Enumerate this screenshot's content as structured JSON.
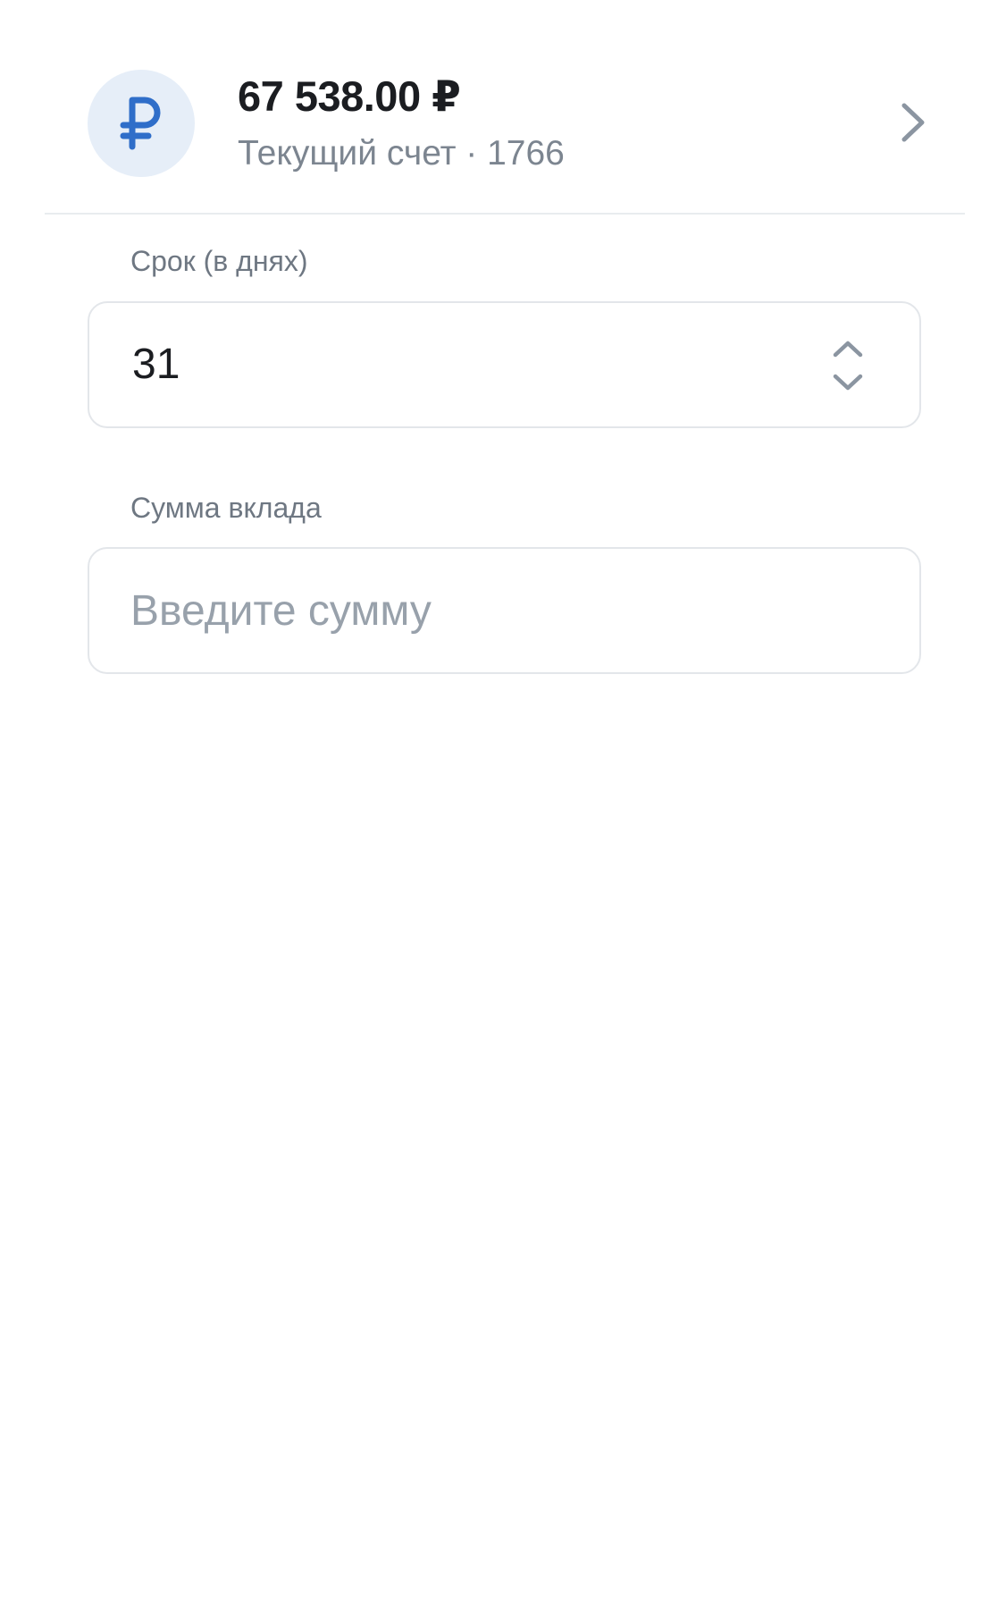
{
  "account": {
    "amount": "67 538.00 ₽",
    "subtitle": "Текущий счет · 1766",
    "currency_icon": "ruble-icon",
    "open_icon": "chevron-right-icon"
  },
  "term_field": {
    "label": "Срок (в днях)",
    "value": "31",
    "stepper_icon": "chevron-up-down-icon"
  },
  "amount_field": {
    "label": "Сумма вклада",
    "value": "",
    "placeholder": "Введите сумму"
  },
  "colors": {
    "accent": "#2f6ec9",
    "avatar_bg": "#e6eef8",
    "border": "#e3e6ea",
    "primary_text": "#1b1d21",
    "secondary_text": "#7c8590",
    "placeholder": "#98a1ab"
  }
}
